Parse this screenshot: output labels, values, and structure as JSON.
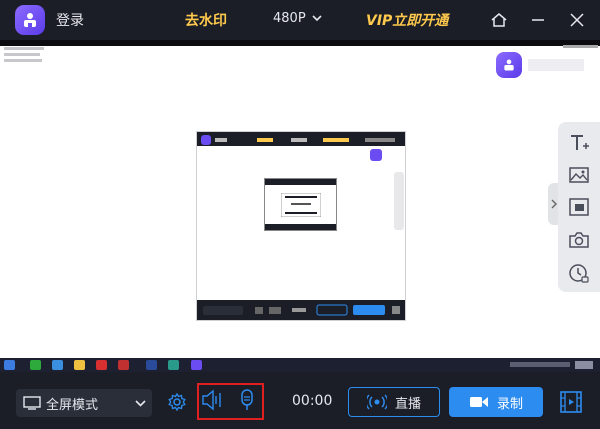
{
  "header": {
    "login_label": "登录",
    "watermark_label": "去水印",
    "resolution": "480P",
    "vip_label": "VIP立即开通"
  },
  "footer": {
    "mode": "全屏模式",
    "timer": "00:00",
    "live_label": "直播",
    "record_label": "录制"
  },
  "icons": {
    "logo": "app-logo-icon",
    "home": "home-icon",
    "minimize": "minimize-icon",
    "close": "close-icon",
    "side_tools": [
      "text-icon",
      "image-icon",
      "picture-in-picture-icon",
      "camera-icon",
      "timer-icon"
    ],
    "bottom": [
      "monitor-icon",
      "settings-icon",
      "speaker-icon",
      "microphone-icon",
      "video-list-icon"
    ]
  },
  "colors": {
    "accent": "#2d8cf0",
    "vip": "#ffc94d",
    "bar": "#1b1e26",
    "highlight": "#e02020"
  }
}
